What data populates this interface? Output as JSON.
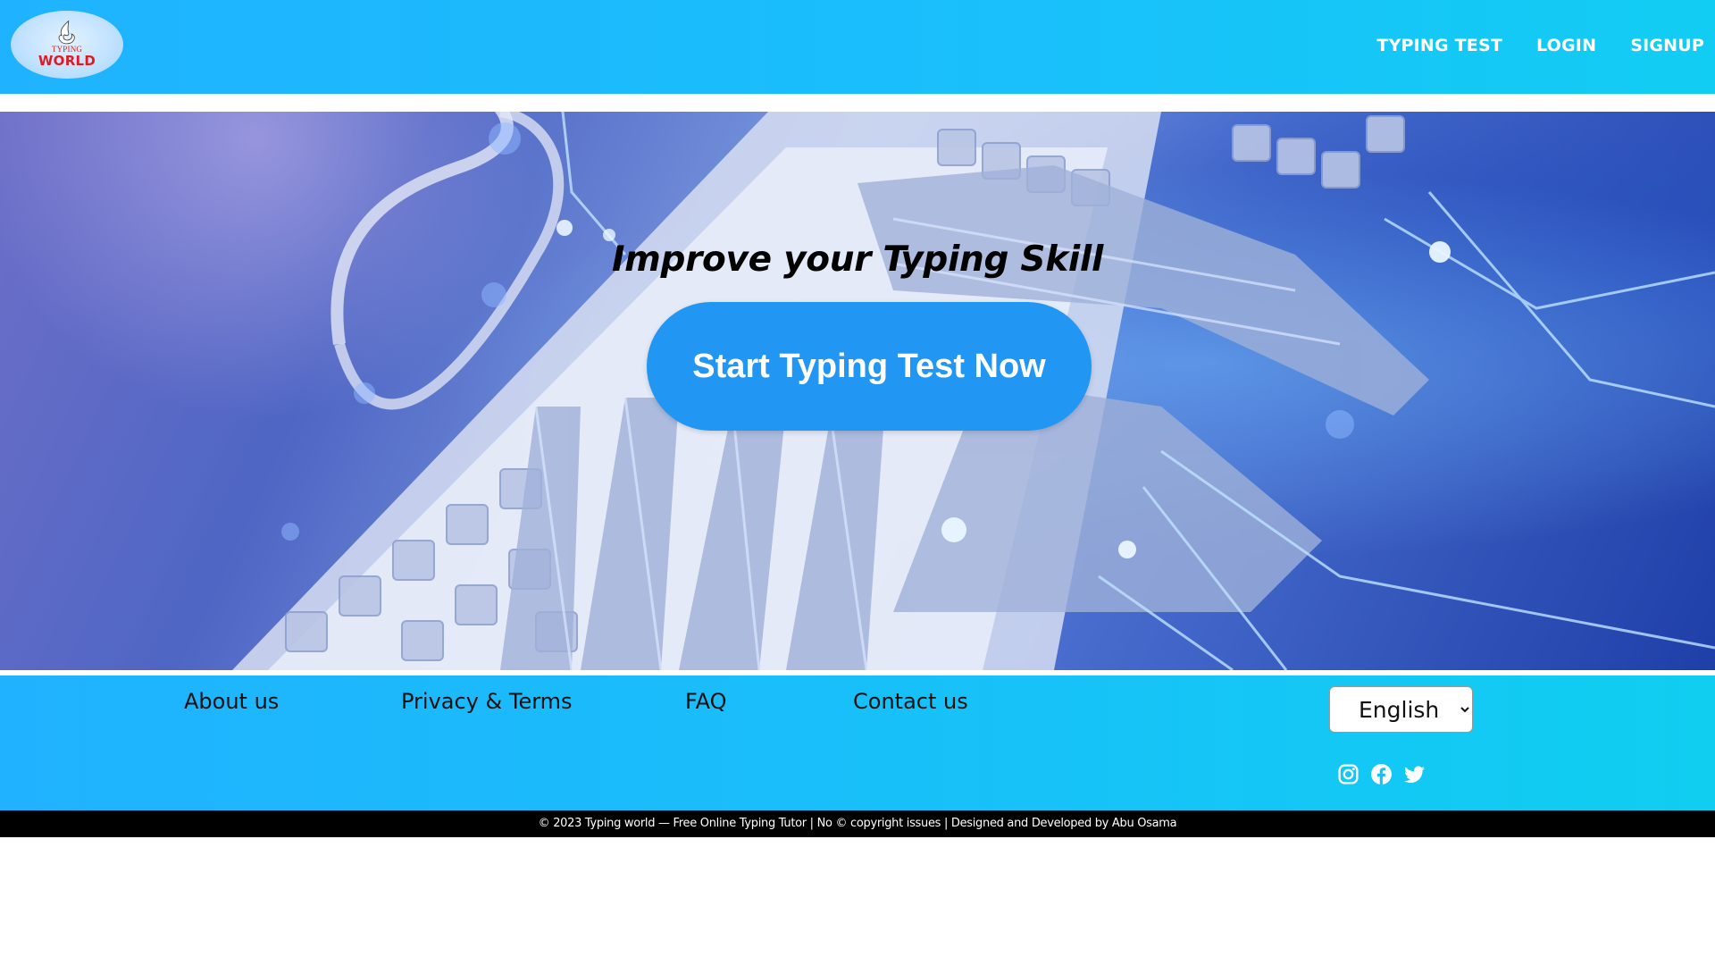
{
  "header": {
    "logo": {
      "small_text": "TYPING",
      "big_text": "WORLD"
    },
    "nav": [
      {
        "label": "TYPING TEST"
      },
      {
        "label": "LOGIN"
      },
      {
        "label": "SIGNUP"
      }
    ]
  },
  "hero": {
    "title": "Improve your Typing Skill",
    "cta_label": "Start Typing Test Now"
  },
  "footer": {
    "links": [
      {
        "label": "About us"
      },
      {
        "label": "Privacy & Terms"
      },
      {
        "label": "FAQ"
      },
      {
        "label": "Contact us"
      }
    ],
    "language": {
      "selected": "English"
    },
    "socials": [
      "instagram-icon",
      "facebook-icon",
      "twitter-icon"
    ],
    "copyright": "© 2023 Typing world — Free Online Typing Tutor | No © copyright issues | Designed and Developed by Abu Osama"
  },
  "colors": {
    "header_bg": "#1fb3ff",
    "cta_bg": "#2196f3",
    "footer_bg": "#17c2f8",
    "copyright_bg": "#000000",
    "logo_red": "#e01a22"
  }
}
